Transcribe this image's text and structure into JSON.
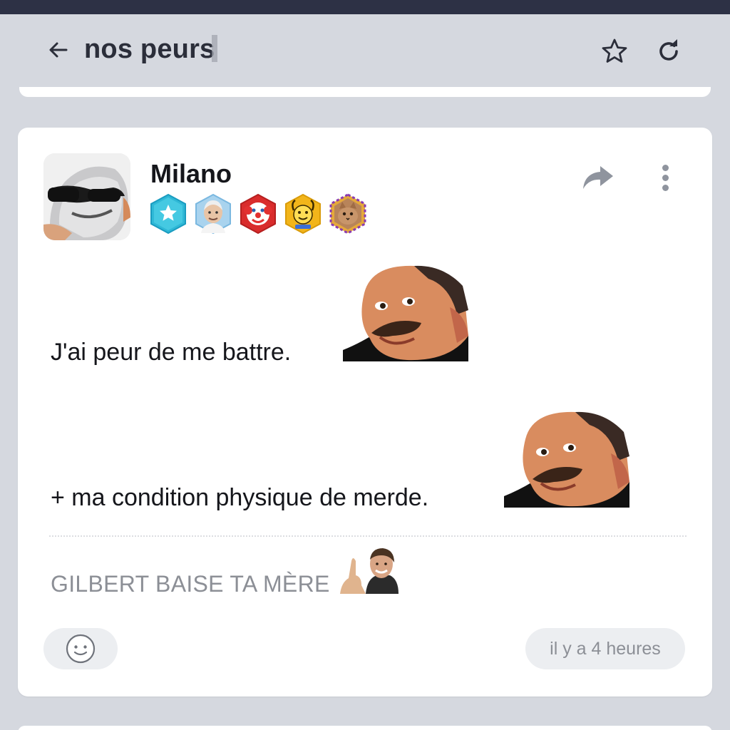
{
  "header": {
    "title": "nos peurs",
    "back_icon": "arrow-left-icon",
    "favorite_icon": "star-icon",
    "refresh_icon": "refresh-icon"
  },
  "post": {
    "author": "Milano",
    "avatar_icon": "avatar-sunglasses-face",
    "badges": [
      {
        "icon": "star-badge-icon",
        "color": "#2fb8d6"
      },
      {
        "icon": "old-man-badge-icon",
        "color": "#7ab8e0"
      },
      {
        "icon": "clown-badge-icon",
        "color": "#d92c2c"
      },
      {
        "icon": "happy-face-badge-icon",
        "color": "#f2b51a"
      },
      {
        "icon": "cat-badge-icon",
        "color": "#8a3bb0"
      }
    ],
    "share_icon": "share-icon",
    "more_icon": "more-vertical-icon",
    "body_lines": [
      "J'ai peur de me battre.",
      "+ ma condition physique de merde."
    ],
    "signature": "GILBERT BAISE TA MÈRE",
    "reaction_icon": "smiley-icon",
    "timestamp": "il y a 4 heures"
  }
}
